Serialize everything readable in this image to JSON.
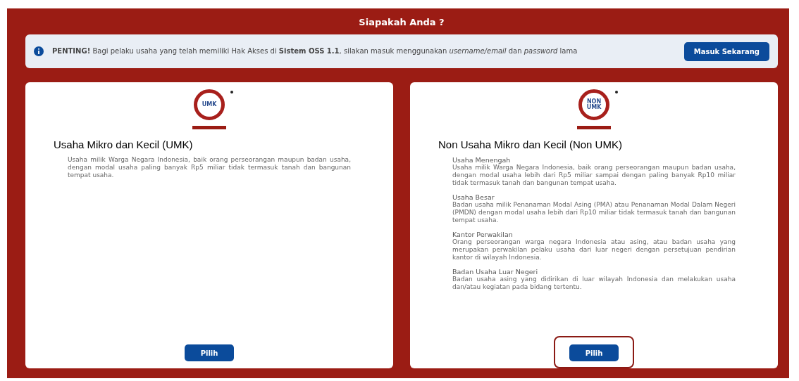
{
  "header": {
    "title": "Siapakah Anda ?"
  },
  "notice": {
    "text": "**PENTING!** Bagi pelaku usaha yang telah memiliki Hak Akses di **Sistem OSS 1.1**, silakan masuk menggunakan *username/email* dan *password* lama",
    "button": "Masuk Sekarang"
  },
  "cards": [
    {
      "logo_text": "UMK",
      "title": "Usaha Mikro dan Kecil (UMK)",
      "sections": [
        {
          "text": "Usaha milik Warga Negara Indonesia, baik orang perseorangan maupun badan usaha, dengan modal usaha paling banyak Rp5 miliar tidak termasuk tanah dan bangunan tempat usaha."
        }
      ],
      "button": "Pilih",
      "highlighted": false
    },
    {
      "logo_text": "NON UMK",
      "title": "Non Usaha Mikro dan Kecil (Non UMK)",
      "sections": [
        {
          "heading": "Usaha Menengah",
          "text": "Usaha milik Warga Negara Indonesia, baik orang perseorangan maupun badan usaha, dengan modal usaha lebih dari Rp5 miliar sampai dengan paling banyak Rp10 miliar tidak termasuk tanah dan bangunan tempat usaha."
        },
        {
          "heading": "Usaha Besar",
          "text": "Badan usaha milik Penanaman Modal Asing (PMA) atau Penanaman Modal Dalam Negeri (PMDN) dengan modal usaha lebih dari Rp10 miliar tidak termasuk tanah dan bangunan tempat usaha."
        },
        {
          "heading": "Kantor Perwakilan",
          "text": "Orang perseorangan warga negara Indonesia atau asing, atau badan usaha yang merupakan perwakilan pelaku usaha dari luar negeri dengan persetujuan pendirian kantor di wilayah Indonesia."
        },
        {
          "heading": "Badan Usaha Luar Negeri",
          "text": "Badan usaha asing yang didirikan di luar wilayah Indonesia dan melakukan usaha dan/atau kegiatan pada bidang tertentu."
        }
      ],
      "button": "Pilih",
      "highlighted": true
    }
  ]
}
